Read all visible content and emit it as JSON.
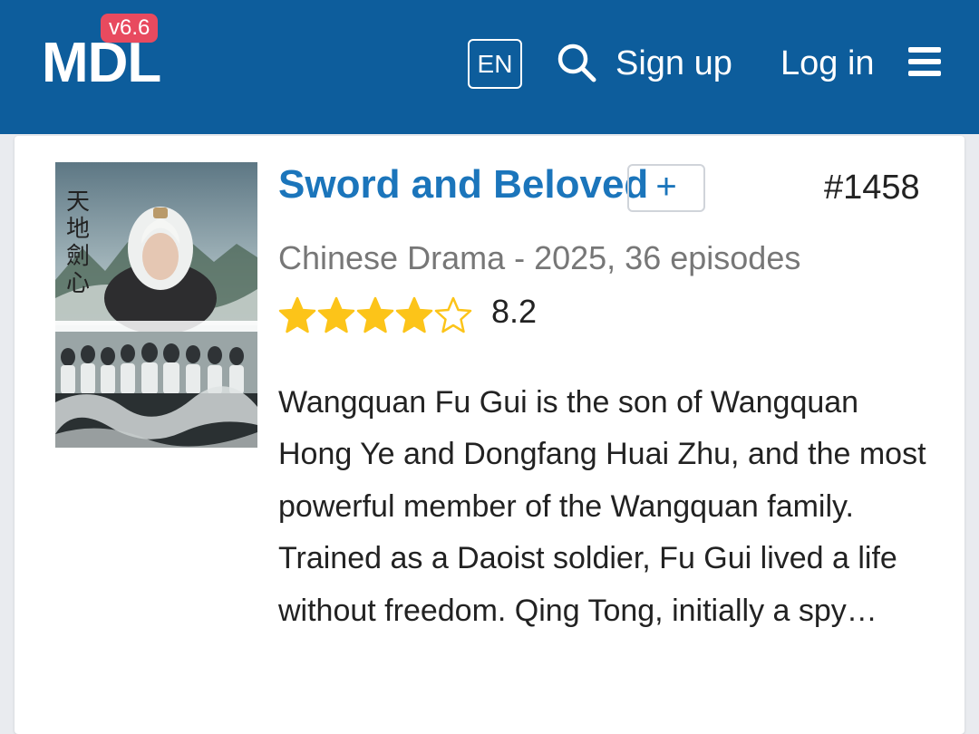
{
  "header": {
    "logo": "MDL",
    "version": "v6.6",
    "language": "EN",
    "signup": "Sign up",
    "login": "Log in",
    "icons": {
      "search": "search-icon",
      "menu": "hamburger-menu-icon"
    }
  },
  "drama": {
    "title": "Sword and Beloved",
    "add_label": "+",
    "rank": "#1458",
    "subtitle": "Chinese Drama - 2025, 36 episodes",
    "rating": "8.2",
    "stars_filled": 4,
    "stars_total": 5,
    "poster_text": "天地劍心",
    "synopsis": "Wangquan Fu Gui is the son of Wangquan Hong Ye and Dongfang Huai Zhu, and the most powerful member of the Wangquan family. Trained as a Daoist soldier, Fu Gui lived a life without freedom. Qing Tong, initially a spy…"
  },
  "colors": {
    "header_bg": "#0d5d9c",
    "version_badge": "#e84a5f",
    "title": "#1b75bb",
    "star": "#fcc419"
  }
}
